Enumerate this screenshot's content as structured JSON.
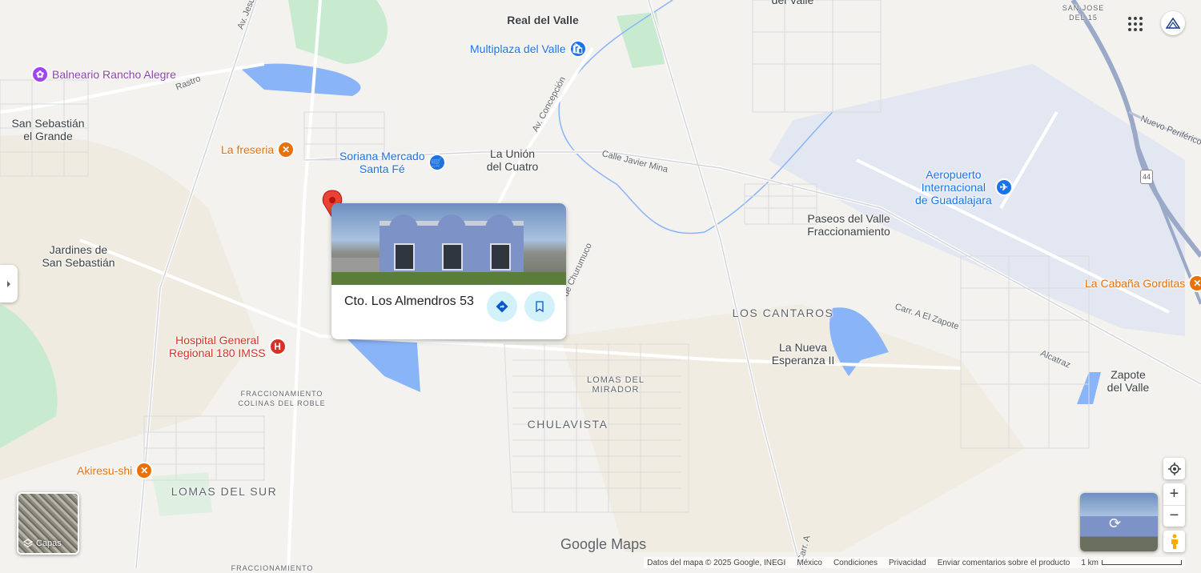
{
  "map": {
    "places": [
      {
        "name": "real-del-valle-label",
        "text": "Real del Valle"
      },
      {
        "name": "san-sebastian-label",
        "line1": "San Sebastián",
        "line2": "el Grande"
      },
      {
        "name": "la-union-label",
        "line1": "La Unión",
        "line2": "del Cuatro"
      },
      {
        "name": "jardines-label",
        "line1": "Jardines de",
        "line2": "San Sebastián"
      },
      {
        "name": "paseos-label",
        "line1": "Paseos del Valle",
        "line2": "Fraccionamiento"
      },
      {
        "name": "los-cantaros-label",
        "text": "LOS CANTAROS"
      },
      {
        "name": "la-nueva-label",
        "line1": "La Nueva",
        "line2": "Esperanza II"
      },
      {
        "name": "zapote-label",
        "line1": "Zapote",
        "line2": "del Valle"
      },
      {
        "name": "lomas-mirador-label",
        "line1": "LOMAS DEL",
        "line2": "MIRADOR"
      },
      {
        "name": "chulavista-label",
        "text": "CHULAVISTA"
      },
      {
        "name": "lomas-sur-label",
        "text": "LOMAS DEL SUR"
      },
      {
        "name": "colinas-label",
        "line1": "FRACCIONAMIENTO",
        "line2": "COLINAS DEL ROBLE"
      },
      {
        "name": "san-jose-label",
        "line1": "SAN JOSE",
        "line2": "DEL 15"
      },
      {
        "name": "del-valle-top-label",
        "text": "del Valle"
      },
      {
        "name": "fracc-bottom-label",
        "text": "FRACCIONAMIENTO"
      }
    ],
    "roads": {
      "jesus": "Av. Jesús M",
      "rastro": "Rastro",
      "concepcion": "Av. Concepción",
      "javier_mina": "Calle Javier Mina",
      "churumuco": "de Churumuco",
      "zapote": "Carr. A El Zapote",
      "alcatraz": "Alcatraz",
      "periferico": "Nuevo Periférico",
      "carr_bottom": "Carr. A",
      "route_44": "44"
    },
    "pois": {
      "multiplaza": "Multiplaza del Valle",
      "rancho": "Balneario Rancho Alegre",
      "freseria": "La freseria",
      "soriana_1": "Soriana Mercado",
      "soriana_2": "Santa Fé",
      "hospital_1": "Hospital General",
      "hospital_2": "Regional 180 IMSS",
      "akiresu": "Akiresu-shi",
      "airport_1": "Aeropuerto",
      "airport_2": "Internacional",
      "airport_3": "de Guadalajara",
      "cabana": "La Cabaña Gorditas"
    }
  },
  "card": {
    "title": "Cto. Los Almendros 53",
    "directions_icon": "directions-icon",
    "save_icon": "bookmark-icon"
  },
  "controls": {
    "layers_label": "Capas",
    "apps_icon": "apps-grid-icon",
    "account_icon": "account-avatar-icon",
    "location_icon": "my-location-icon",
    "zoom_in": "+",
    "zoom_out": "−",
    "pegman_icon": "pegman-icon",
    "collapse_icon": "chevron-right-icon"
  },
  "branding": {
    "google": "Google",
    "maps": "Maps"
  },
  "footer": {
    "data": "Datos del mapa © 2025 Google, INEGI",
    "country": "México",
    "terms": "Condiciones",
    "privacy": "Privacidad",
    "feedback": "Enviar comentarios sobre el producto",
    "scale": "1 km"
  },
  "colors": {
    "water": "#8ab4f8",
    "park": "#c8ebd0",
    "airport": "#e8eaf6",
    "highway": "#9aa9c7",
    "pin": "#ea4335"
  }
}
